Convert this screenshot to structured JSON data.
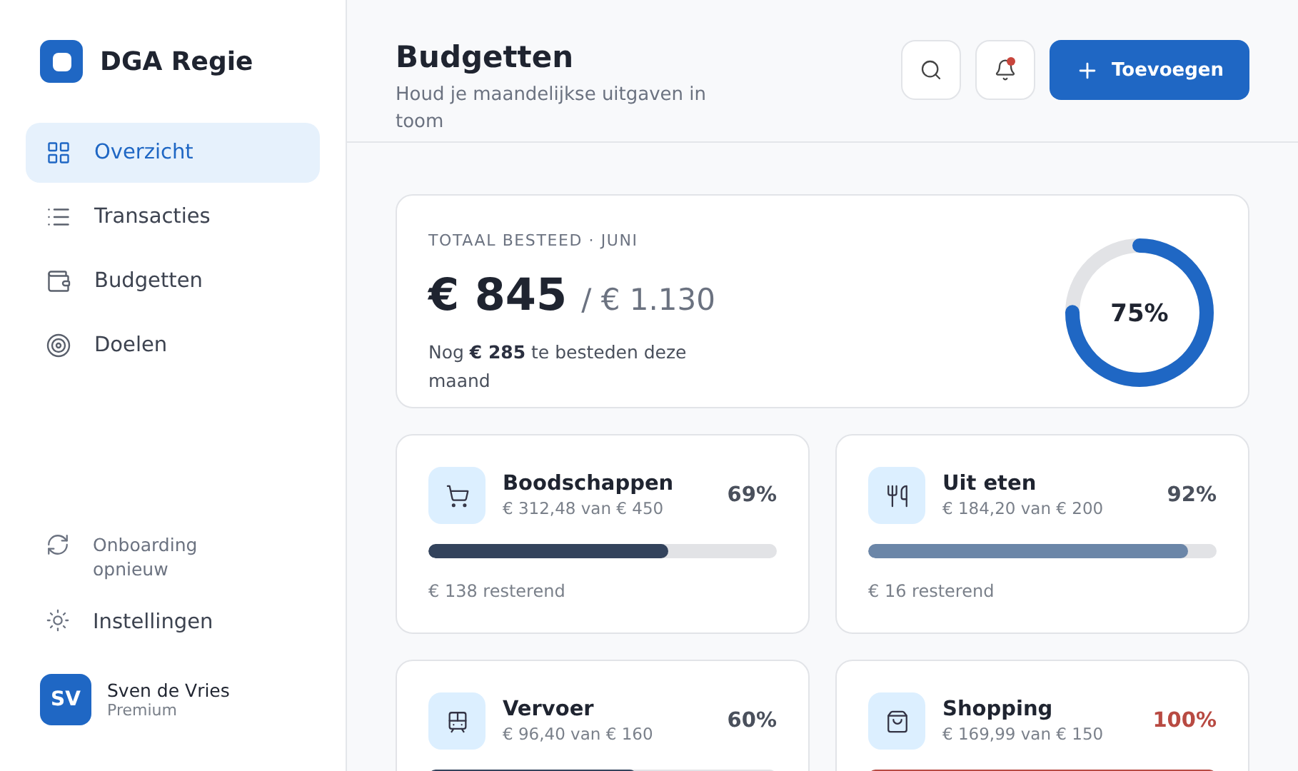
{
  "brand": {
    "name": "DGA Regie"
  },
  "nav": [
    {
      "label": "Overzicht",
      "kind": "grid",
      "selected": true
    },
    {
      "label": "Transacties",
      "kind": "list",
      "selected": false
    },
    {
      "label": "Budgetten",
      "kind": "wallet",
      "selected": false
    },
    {
      "label": "Doelen",
      "kind": "target",
      "selected": false
    }
  ],
  "sidebar_footer": [
    {
      "label": "Onboarding opnieuw",
      "kind": "muted"
    },
    {
      "label": "Instellingen",
      "kind": "normal"
    }
  ],
  "user": {
    "initials": "SV",
    "name": "Sven de Vries",
    "plan": "Premium"
  },
  "header": {
    "title": "Budgetten",
    "subtitle": "Houd je maandelijkse uitgaven in toom",
    "notification_dot": true,
    "add_button": "Toevoegen"
  },
  "summary": {
    "label": "TOTAAL BESTEED · JUNI",
    "spent": "€ 845",
    "total": "/ € 1.130",
    "note": "Nog **€ 285** te besteden deze maand",
    "level": 0.75,
    "percent": "75%"
  },
  "budgets": [
    {
      "name": "Boodschappen",
      "kind": "cart",
      "amount": "€ 312,48 van € 450",
      "percent": "69%",
      "over_budget": false,
      "level": 0.69,
      "color": "#33435c",
      "remaining": "€ 138 resterend"
    },
    {
      "name": "Uit eten",
      "kind": "utensils",
      "amount": "€ 184,20 van € 200",
      "percent": "92%",
      "over_budget": false,
      "level": 0.92,
      "color": "#6b86a8",
      "remaining": "€ 16 resterend"
    },
    {
      "name": "Vervoer",
      "kind": "train",
      "amount": "€ 96,40 van € 160",
      "percent": "60%",
      "over_budget": false,
      "level": 0.6,
      "color": "#33435c"
    },
    {
      "name": "Shopping",
      "kind": "bag",
      "amount": "€ 169,99 van € 150",
      "percent": "100%",
      "over_budget": true,
      "level": 1,
      "color": "#b84a42"
    }
  ]
}
